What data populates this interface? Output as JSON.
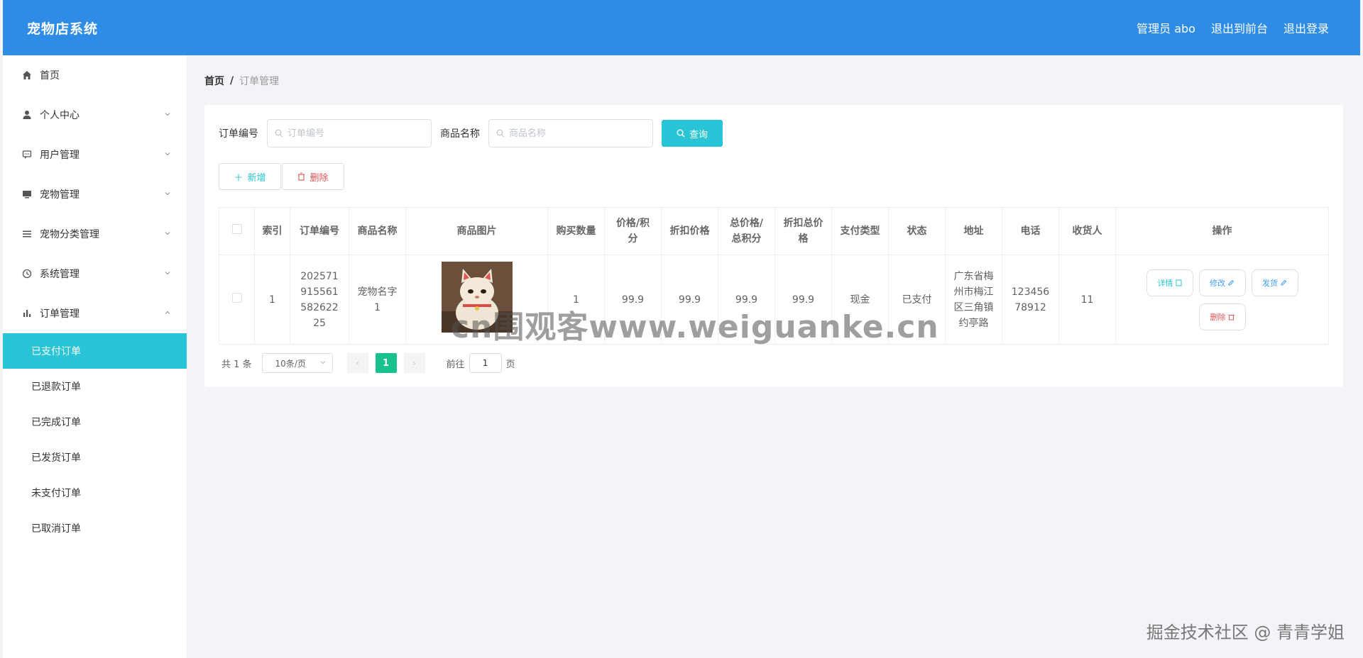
{
  "header": {
    "brand": "宠物店系统",
    "admin": "管理员 abo",
    "to_front": "退出到前台",
    "logout": "退出登录"
  },
  "sidebar": {
    "items": [
      {
        "label": "首页",
        "icon": "home-icon"
      },
      {
        "label": "个人中心",
        "icon": "user-icon"
      },
      {
        "label": "用户管理",
        "icon": "chat-icon"
      },
      {
        "label": "宠物管理",
        "icon": "monitor-icon"
      },
      {
        "label": "宠物分类管理",
        "icon": "list-icon"
      },
      {
        "label": "系统管理",
        "icon": "clock-icon"
      },
      {
        "label": "订单管理",
        "icon": "bar-chart-icon"
      }
    ],
    "order_sub": [
      "已支付订单",
      "已退款订单",
      "已完成订单",
      "已发货订单",
      "未支付订单",
      "已取消订单"
    ]
  },
  "breadcrumb": {
    "home": "首页",
    "sep": "/",
    "current": "订单管理"
  },
  "search": {
    "order_no_label": "订单编号",
    "order_no_placeholder": "订单编号",
    "goods_label": "商品名称",
    "goods_placeholder": "商品名称",
    "query_label": "查询"
  },
  "actions": {
    "add_label": "新增",
    "delete_label": "删除"
  },
  "table": {
    "headers": [
      "索引",
      "订单编号",
      "商品名称",
      "商品图片",
      "购买数量",
      "价格/积分",
      "折扣价格",
      "总价格/总积分",
      "折扣总价格",
      "支付类型",
      "状态",
      "地址",
      "电话",
      "收货人",
      "操作"
    ],
    "rows": [
      {
        "index": "1",
        "order_no": "20257191556158262225",
        "goods": "宠物名字1",
        "qty": "1",
        "price": "99.9",
        "discount_price": "99.9",
        "total": "99.9",
        "discount_total": "99.9",
        "pay_type": "现金",
        "status": "已支付",
        "address": "广东省梅州市梅江区三角镇约亭路",
        "phone": "12345678912",
        "receiver": "11",
        "ops": {
          "detail": "详情",
          "edit": "修改",
          "ship": "发货",
          "remove": "删除"
        }
      }
    ]
  },
  "pager": {
    "total": "共 1 条",
    "page_size": "10条/页",
    "current_page": "1",
    "goto_prefix": "前往",
    "goto_value": "1",
    "goto_suffix": "页"
  },
  "watermark": "cn围观客www.weiguanke.cn",
  "footer_mark": "掘金技术社区 @ 青青学姐",
  "colors": {
    "header_bg": "#2f8ce6",
    "accent": "#29c4d6",
    "pager_active": "#19c28c",
    "danger": "#e45656"
  }
}
